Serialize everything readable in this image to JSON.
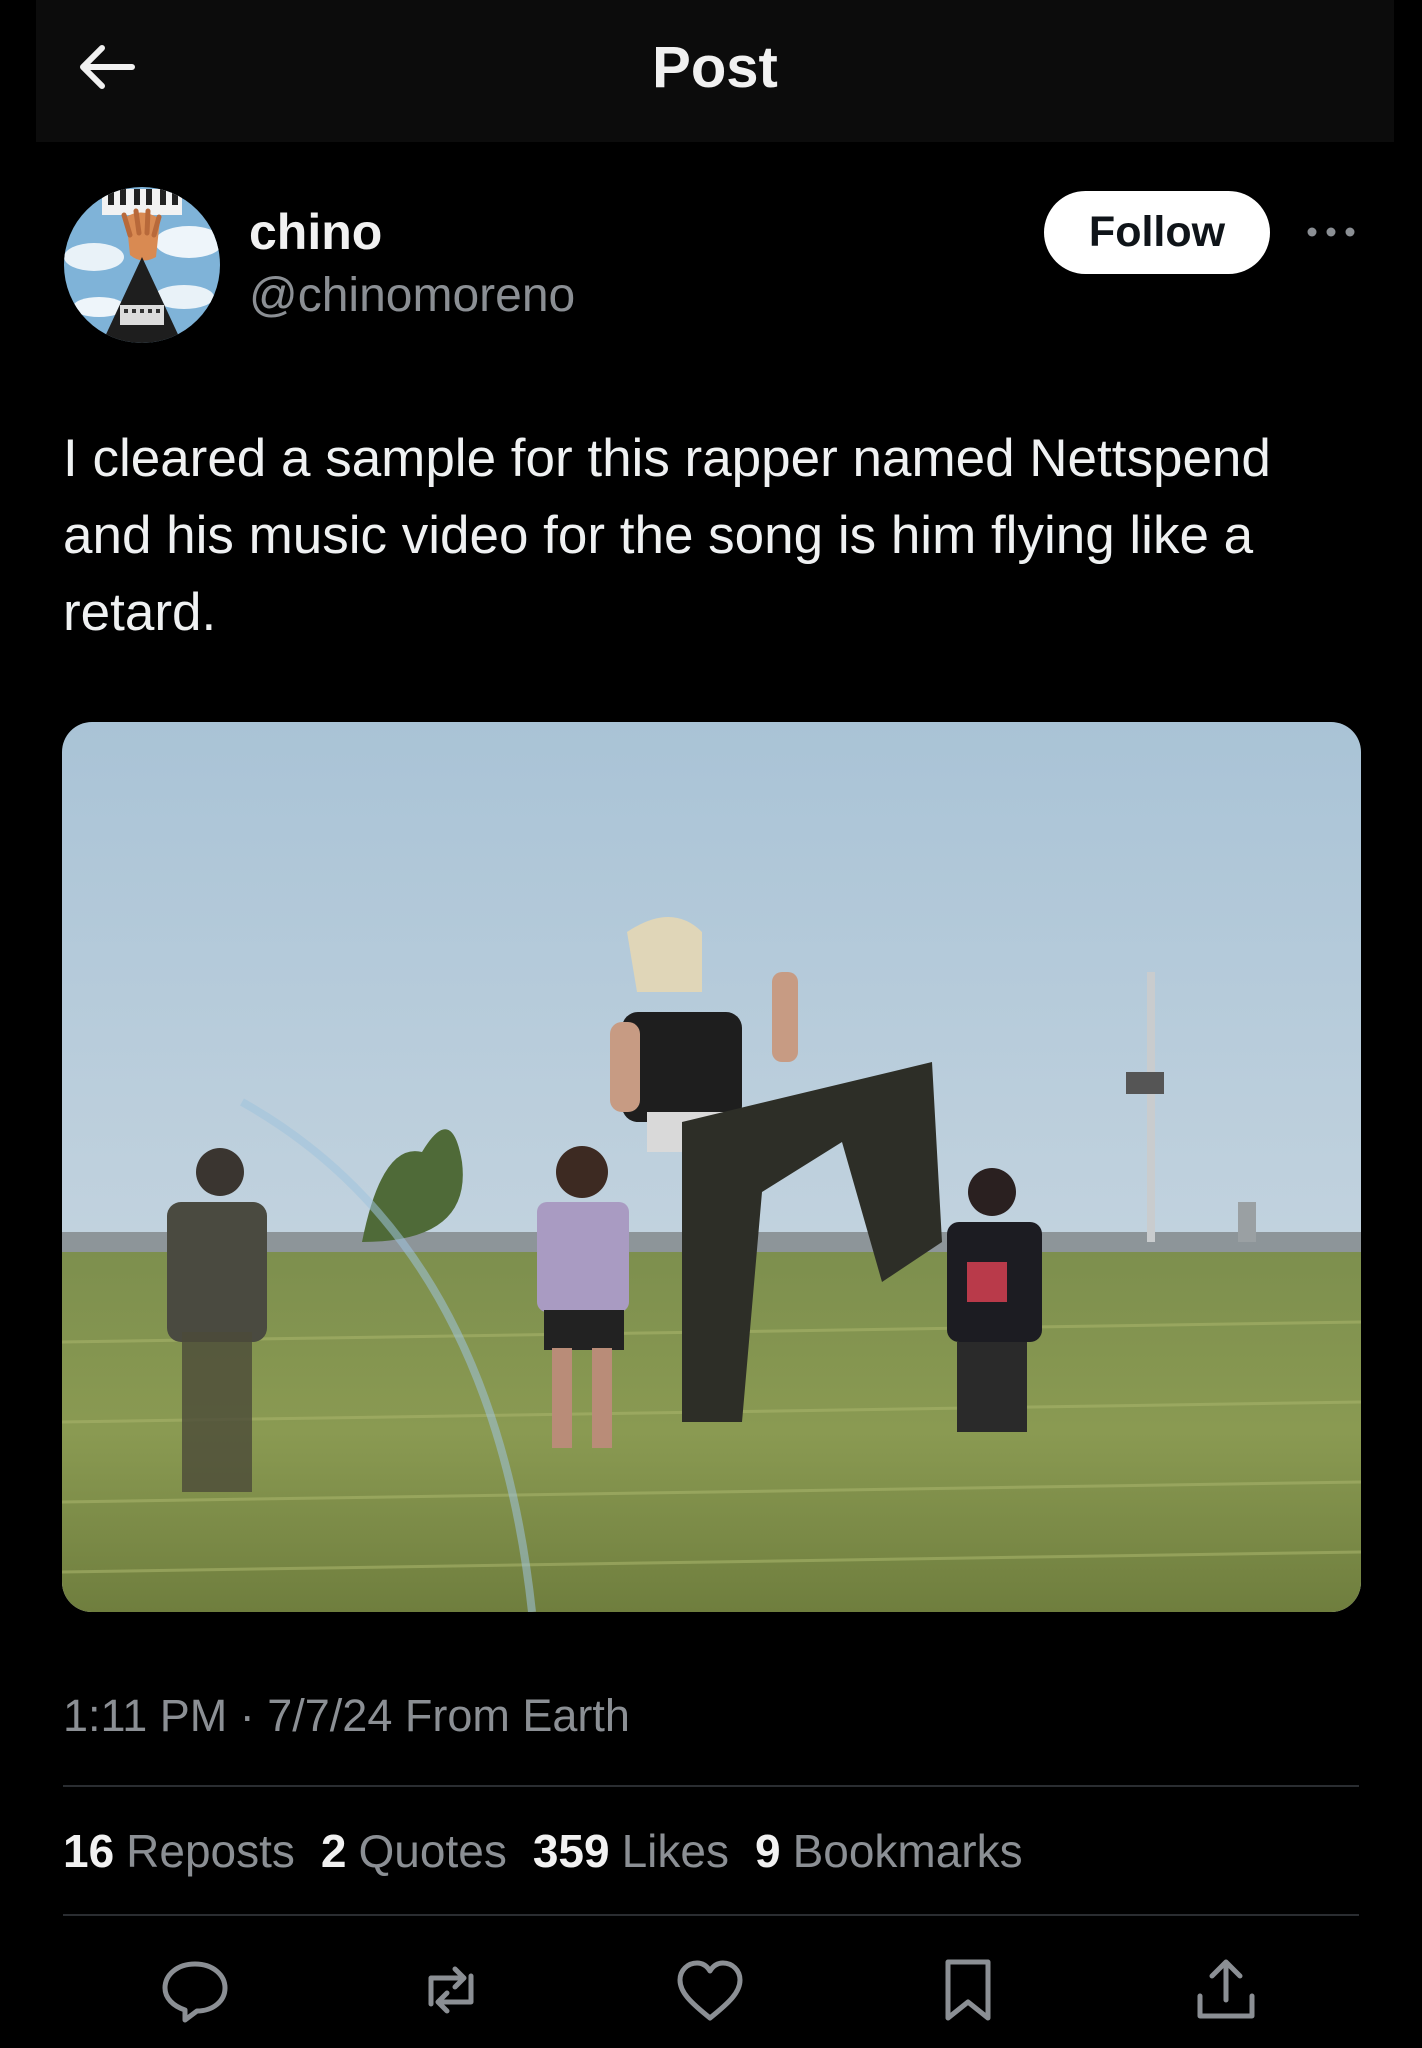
{
  "header": {
    "title": "Post",
    "back_icon": "arrow-left-icon"
  },
  "author": {
    "display_name": "chino",
    "handle": "@chinomoreno",
    "follow_label": "Follow",
    "more_icon": "more-horizontal-icon"
  },
  "post": {
    "text": "I cleared a sample for this rapper named Nettspend and his music video for the song is him flying like a retard.",
    "meta": "1:11 PM · 7/7/24 From Earth"
  },
  "stats": [
    {
      "count": "16",
      "label": "Reposts"
    },
    {
      "count": "2",
      "label": "Quotes"
    },
    {
      "count": "359",
      "label": "Likes"
    },
    {
      "count": "9",
      "label": "Bookmarks"
    }
  ],
  "actions": [
    {
      "icon": "reply-icon"
    },
    {
      "icon": "repost-icon"
    },
    {
      "icon": "like-icon"
    },
    {
      "icon": "bookmark-icon"
    },
    {
      "icon": "share-icon"
    }
  ],
  "colors": {
    "background": "#000000",
    "text_primary": "#e7e9ea",
    "text_secondary": "#8b8f94",
    "follow_bg": "#ffffff"
  }
}
